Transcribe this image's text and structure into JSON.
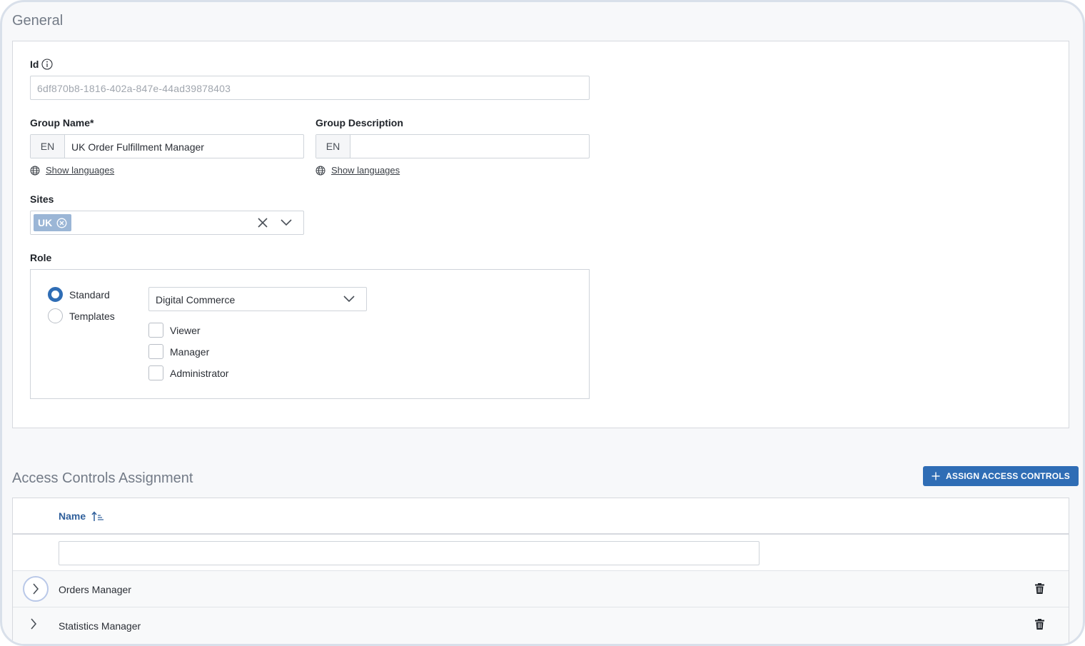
{
  "general": {
    "title": "General",
    "id": {
      "label": "Id",
      "value": "6df870b8-1816-402a-847e-44ad39878403"
    },
    "group_name": {
      "label": "Group Name*",
      "lang": "EN",
      "value": "UK Order Fulfillment Manager",
      "show_languages": "Show languages"
    },
    "group_description": {
      "label": "Group Description",
      "lang": "EN",
      "value": "",
      "show_languages": "Show languages"
    },
    "sites": {
      "label": "Sites",
      "chips": [
        "UK"
      ]
    },
    "role": {
      "label": "Role",
      "radios": [
        {
          "label": "Standard",
          "checked": true
        },
        {
          "label": "Templates",
          "checked": false
        }
      ],
      "select_value": "Digital Commerce",
      "checkboxes": [
        {
          "label": "Viewer",
          "checked": false
        },
        {
          "label": "Manager",
          "checked": false
        },
        {
          "label": "Administrator",
          "checked": false
        }
      ]
    }
  },
  "access_controls": {
    "title": "Access Controls Assignment",
    "assign_button": "ASSIGN ACCESS CONTROLS",
    "column_name": "Name",
    "filter_value": "",
    "rows": [
      {
        "name": "Orders Manager"
      },
      {
        "name": "Statistics Manager"
      }
    ]
  },
  "colors": {
    "primary": "#2f6db5",
    "chip": "#9bb6d6",
    "header_link": "#2f5f9b"
  }
}
